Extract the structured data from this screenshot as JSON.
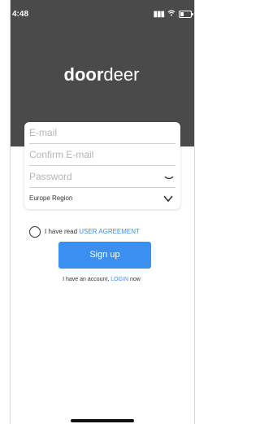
{
  "status": {
    "time": "4:48"
  },
  "logo": {
    "bold": "door",
    "regular": "deer"
  },
  "form": {
    "email_placeholder": "E-mail",
    "confirm_email_placeholder": "Confirm E-mail",
    "password_placeholder": "Password",
    "region_value": "Europe Region"
  },
  "agreement": {
    "text": "I have read ",
    "link": "USER AGREEMENT"
  },
  "signup": {
    "label": "Sign up"
  },
  "login_row": {
    "prefix": "I have an account, ",
    "link": "LOGIN",
    "suffix": " now"
  },
  "colors": {
    "header_bg": "#4a4a4a",
    "accent": "#3a8ff0"
  }
}
